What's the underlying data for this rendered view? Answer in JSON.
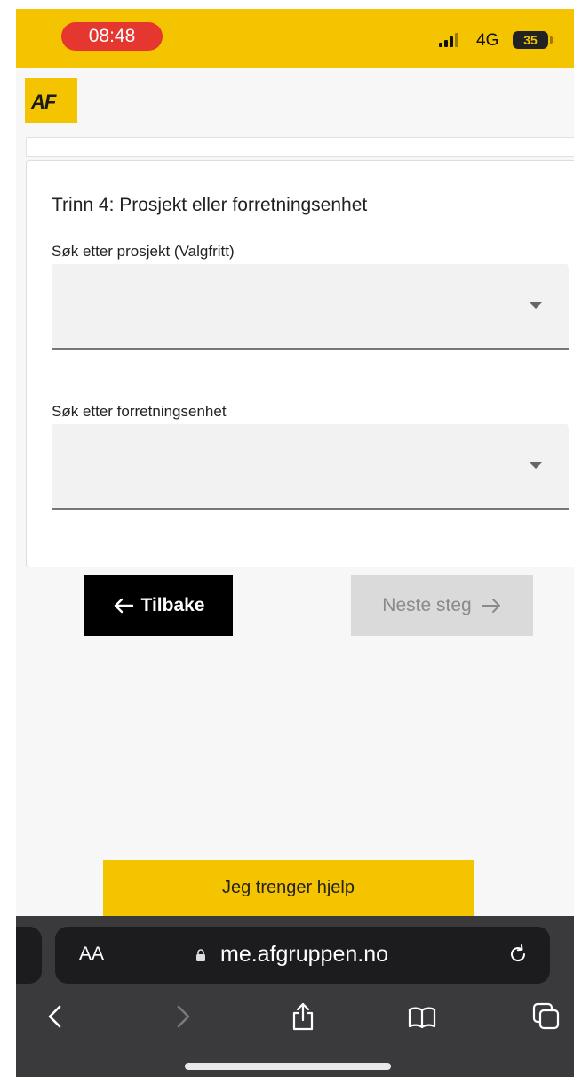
{
  "status_bar": {
    "time": "08:48",
    "network": "4G",
    "battery": "35",
    "background_color": "#f5c400",
    "time_pill_color": "#e5372f"
  },
  "header": {
    "logo_text": "AF"
  },
  "form": {
    "step_title": "Trinn 4: Prosjekt eller forretningsenhet",
    "project_label": "Søk etter prosjekt (Valgfritt)",
    "project_value": "",
    "business_unit_label": "Søk etter forretningsenhet",
    "business_unit_value": ""
  },
  "navigation": {
    "back_label": "Tilbake",
    "back_icon": "arrow-left-icon",
    "next_label": "Neste steg",
    "next_icon": "arrow-right-icon",
    "next_disabled": true
  },
  "help": {
    "label": "Jeg trenger hjelp",
    "color": "#f5c400"
  },
  "browser": {
    "text_size_label": "AA",
    "url": "me.afgruppen.no",
    "icons": [
      "lock-icon",
      "reload-icon",
      "back-icon",
      "forward-icon",
      "share-icon",
      "bookmarks-icon",
      "tabs-icon"
    ]
  }
}
